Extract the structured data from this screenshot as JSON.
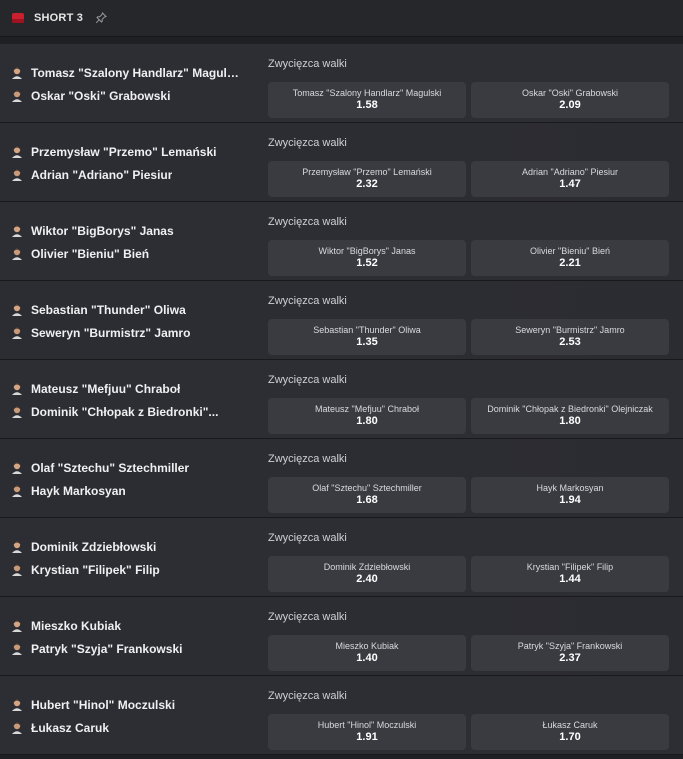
{
  "header": {
    "title": "SHORT 3"
  },
  "market_label": "Zwycięzca walki",
  "events": [
    {
      "f1": "Tomasz \"Szalony Handlarz\" Magulski",
      "f2": "Oskar \"Oski\" Grabowski",
      "o1_name": "Tomasz \"Szalony Handlarz\" Magulski",
      "o1_val": "1.58",
      "o2_name": "Oskar \"Oski\" Grabowski",
      "o2_val": "2.09"
    },
    {
      "f1": "Przemysław \"Przemo\" Lemański",
      "f2": "Adrian \"Adriano\" Piesiur",
      "o1_name": "Przemysław \"Przemo\" Lemański",
      "o1_val": "2.32",
      "o2_name": "Adrian \"Adriano\" Piesiur",
      "o2_val": "1.47"
    },
    {
      "f1": "Wiktor \"BigBorys\" Janas",
      "f2": "Olivier \"Bieniu\" Bień",
      "o1_name": "Wiktor \"BigBorys\" Janas",
      "o1_val": "1.52",
      "o2_name": "Olivier \"Bieniu\" Bień",
      "o2_val": "2.21"
    },
    {
      "f1": "Sebastian \"Thunder\" Oliwa",
      "f2": "Seweryn \"Burmistrz\" Jamro",
      "o1_name": "Sebastian \"Thunder\" Oliwa",
      "o1_val": "1.35",
      "o2_name": "Seweryn \"Burmistrz\" Jamro",
      "o2_val": "2.53"
    },
    {
      "f1": "Mateusz \"Mefjuu\" Chraboł",
      "f2": "Dominik \"Chłopak z Biedronki\"...",
      "o1_name": "Mateusz \"Mefjuu\" Chraboł",
      "o1_val": "1.80",
      "o2_name": "Dominik \"Chłopak z Biedronki\" Olejniczak",
      "o2_val": "1.80"
    },
    {
      "f1": "Olaf \"Sztechu\" Sztechmiller",
      "f2": "Hayk Markosyan",
      "o1_name": "Olaf \"Sztechu\" Sztechmiller",
      "o1_val": "1.68",
      "o2_name": "Hayk Markosyan",
      "o2_val": "1.94"
    },
    {
      "f1": "Dominik Zdziebłowski",
      "f2": "Krystian \"Filipek\" Filip",
      "o1_name": "Dominik Zdziebłowski",
      "o1_val": "2.40",
      "o2_name": "Krystian \"Filipek\" Filip",
      "o2_val": "1.44"
    },
    {
      "f1": "Mieszko Kubiak",
      "f2": "Patryk \"Szyja\" Frankowski",
      "o1_name": "Mieszko Kubiak",
      "o1_val": "1.40",
      "o2_name": "Patryk \"Szyja\" Frankowski",
      "o2_val": "2.37"
    },
    {
      "f1": "Hubert \"Hinol\" Moczulski",
      "f2": "Łukasz Caruk",
      "o1_name": "Hubert \"Hinol\" Moczulski",
      "o1_val": "1.91",
      "o2_name": "Łukasz Caruk",
      "o2_val": "1.70"
    }
  ]
}
